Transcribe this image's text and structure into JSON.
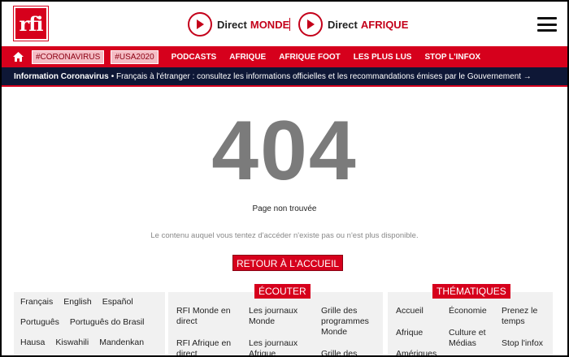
{
  "header": {
    "logo_text": "rfi",
    "direct_monde": {
      "label": "Direct",
      "area": "MONDE"
    },
    "direct_afrique": {
      "label": "Direct",
      "area": "AFRIQUE"
    }
  },
  "nav": {
    "chips": [
      "#CORONAVIRUS",
      "#USA2020"
    ],
    "links": [
      "PODCASTS",
      "AFRIQUE",
      "AFRIQUE FOOT",
      "LES PLUS LUS",
      "STOP L'INFOX"
    ]
  },
  "info_bar": {
    "title": "Information Coronavirus",
    "text": "• Français à l'étranger : consultez les informations officielles et les recommandations émises par le Gouvernement →"
  },
  "error": {
    "code": "404",
    "title": "Page non trouvée",
    "description": "Le contenu auquel vous tentez d'accéder n'existe pas ou n'est plus disponible.",
    "back_label": "RETOUR À L'ACCUEIL"
  },
  "footer": {
    "languages": [
      [
        "Français",
        "English",
        "Español"
      ],
      [
        "Português",
        "Português do Brasil"
      ],
      [
        "Hausa",
        "Kiswahili",
        "Mandenkan"
      ]
    ],
    "ecouter": {
      "heading": "ÉCOUTER",
      "items": [
        "RFI Monde en direct",
        "Les journaux Monde",
        "Grille des programmes Monde",
        "RFI Afrique en direct",
        "Les journaux Afrique",
        "Grille des"
      ]
    },
    "thematiques": {
      "heading": "THÉMATIQUES",
      "items": [
        "Accueil",
        "Économie",
        "Prenez le temps",
        "Afrique",
        "Culture et Médias",
        "Stop l'infox",
        "Amériques"
      ]
    }
  },
  "colors": {
    "brand_red": "#d6001c",
    "navy": "#0e1736",
    "grey_404": "#7b7b7b"
  }
}
